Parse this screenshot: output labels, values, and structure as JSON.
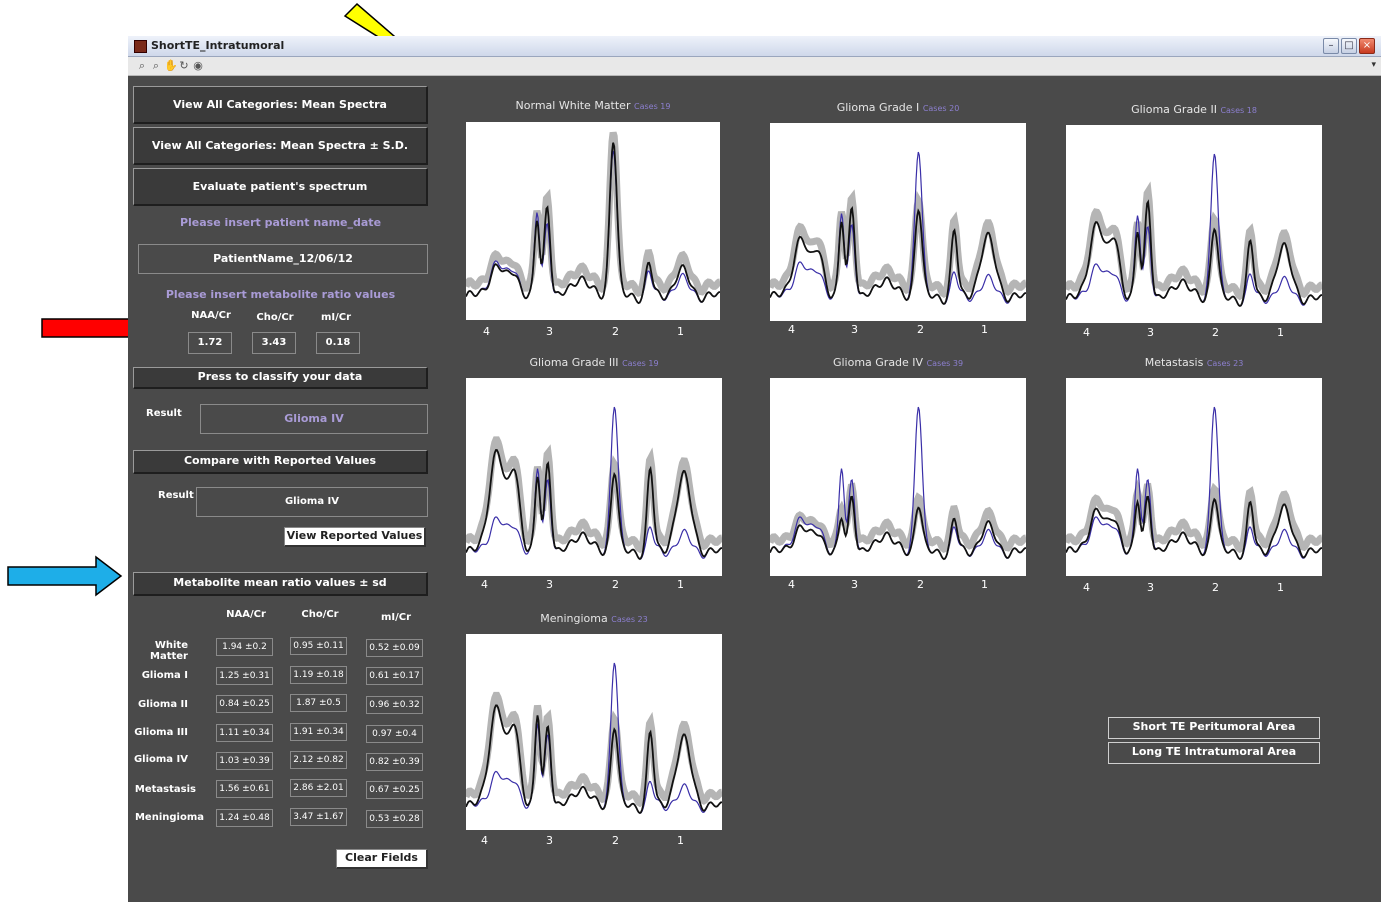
{
  "window": {
    "title": "ShortTE_Intratumoral",
    "toolbar_arrow": "▾"
  },
  "toolbar": {
    "icons": [
      "zoom-in-icon",
      "zoom-out-icon",
      "pan-icon",
      "rotate-icon",
      "data-cursor-icon"
    ],
    "glyphs": [
      "⌕",
      "⌕",
      "✋",
      "↻",
      "◉"
    ]
  },
  "buttons": {
    "view_mean": "View All Categories: Mean Spectra",
    "view_mean_sd": "View All Categories: Mean Spectra ± S.D.",
    "evaluate": "Evaluate patient's spectrum",
    "classify": "Press to classify your data",
    "compare": "Compare with Reported Values",
    "view_reported": "View Reported Values",
    "metabolite_header": "Metabolite mean ratio values ± sd",
    "clear": "Clear Fields",
    "short_te_peri": "Short TE Peritumoral Area",
    "long_te_intra": "Long TE Intratumoral Area"
  },
  "patient": {
    "prompt": "Please insert patient name_date",
    "name_value": "PatientName_12/06/12",
    "ratio_prompt": "Please insert metabolite ratio values",
    "ratio_labels": [
      "NAA/Cr",
      "Cho/Cr",
      "mI/Cr"
    ],
    "ratio_values": [
      "1.72",
      "3.43",
      "0.18"
    ]
  },
  "results": {
    "label": "Result",
    "classify_result": "Glioma IV",
    "compare_result": "Glioma IV"
  },
  "metabolite_table": {
    "columns": [
      "NAA/Cr",
      "Cho/Cr",
      "mI/Cr"
    ],
    "rows": [
      {
        "label": "White Matter",
        "values": [
          "1.94 ±0.2",
          "0.95 ±0.11",
          "0.52 ±0.09"
        ]
      },
      {
        "label": "Glioma I",
        "values": [
          "1.25 ±0.31",
          "1.19 ±0.18",
          "0.61 ±0.17"
        ]
      },
      {
        "label": "Glioma II",
        "values": [
          "0.84 ±0.25",
          "1.87 ±0.5",
          "0.96 ±0.32"
        ]
      },
      {
        "label": "Glioma III",
        "values": [
          "1.11 ±0.34",
          "1.91 ±0.34",
          "0.97 ±0.4"
        ]
      },
      {
        "label": "Glioma IV",
        "values": [
          "1.03 ±0.39",
          "2.12 ±0.82",
          "0.82 ±0.39"
        ]
      },
      {
        "label": "Metastasis",
        "values": [
          "1.56 ±0.61",
          "2.86 ±2.01",
          "0.67 ±0.25"
        ]
      },
      {
        "label": "Meningioma",
        "values": [
          "1.24 ±0.48",
          "3.47 ±1.67",
          "0.53 ±0.28"
        ]
      }
    ]
  },
  "plots": [
    {
      "title": "Normal White Matter",
      "cases": "Cases 19",
      "ticks": [
        "4",
        "3",
        "2",
        "1"
      ]
    },
    {
      "title": "Glioma Grade I",
      "cases": "Cases 20",
      "ticks": [
        "4",
        "3",
        "2",
        "1"
      ]
    },
    {
      "title": "Glioma Grade II",
      "cases": "Cases 18",
      "ticks": [
        "4",
        "3",
        "2",
        "1"
      ]
    },
    {
      "title": "Glioma Grade III",
      "cases": "Cases 19",
      "ticks": [
        "4",
        "3",
        "2",
        "1"
      ]
    },
    {
      "title": "Glioma Grade IV",
      "cases": "Cases 39",
      "ticks": [
        "4",
        "3",
        "2",
        "1"
      ]
    },
    {
      "title": "Metastasis",
      "cases": "Cases 23",
      "ticks": [
        "4",
        "3",
        "2",
        "1"
      ]
    },
    {
      "title": "Meningioma",
      "cases": "Cases 23",
      "ticks": [
        "4",
        "3",
        "2",
        "1"
      ]
    }
  ],
  "colors": {
    "panel_bg": "#4a4a4a",
    "lilac_text": "#a99bd6",
    "spectrum_mean": "#111111",
    "spectrum_sd": "#b5b5b5",
    "spectrum_patient": "#3a2fa8",
    "arrow_yellow": "#ffff00",
    "arrow_red": "#ff0000",
    "arrow_blue": "#1eaee8"
  }
}
